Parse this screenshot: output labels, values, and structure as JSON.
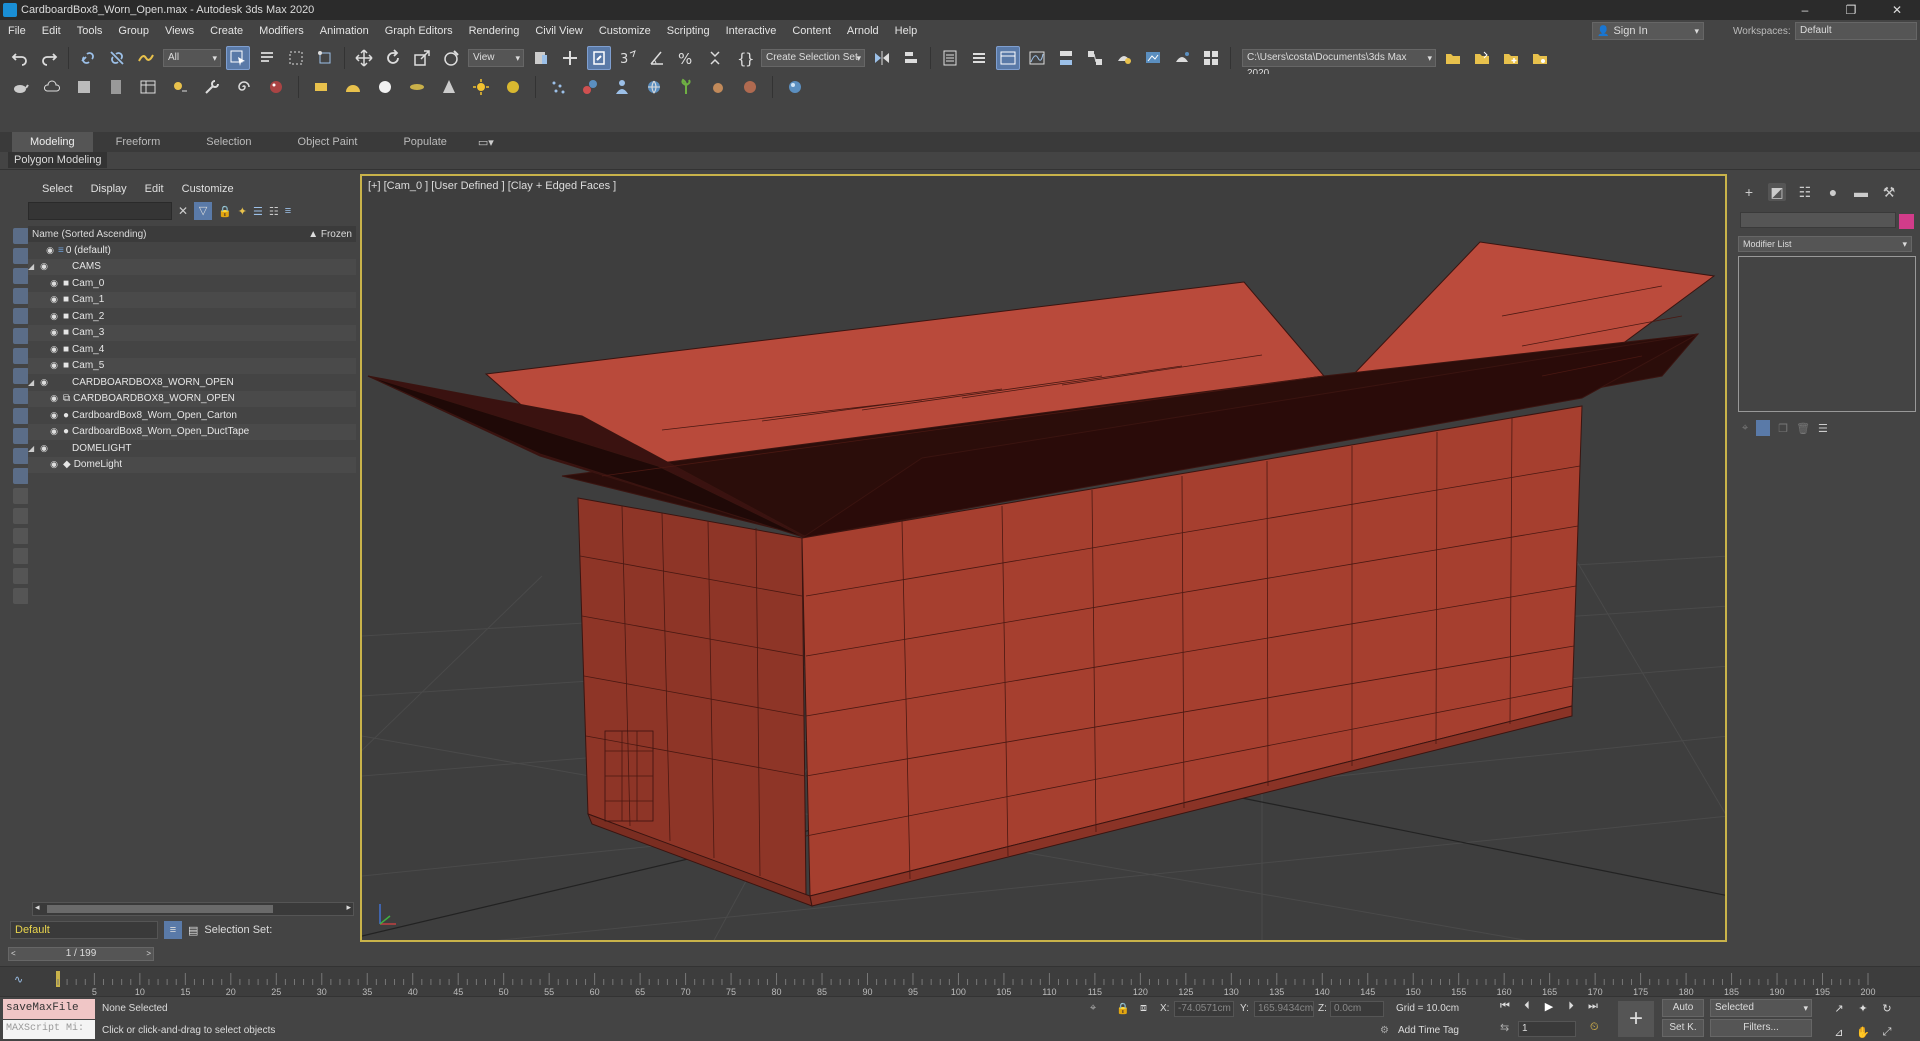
{
  "window": {
    "title": "CardboardBox8_Worn_Open.max - Autodesk 3ds Max 2020"
  },
  "menu": [
    "File",
    "Edit",
    "Tools",
    "Group",
    "Views",
    "Create",
    "Modifiers",
    "Animation",
    "Graph Editors",
    "Rendering",
    "Civil View",
    "Customize",
    "Scripting",
    "Interactive",
    "Content",
    "Arnold",
    "Help"
  ],
  "account": {
    "signin": "Sign In",
    "workspaces_label": "Workspaces:",
    "workspace": "Default"
  },
  "toolbar": {
    "filter": "All",
    "ref_coord": "View",
    "selection_set": "Create Selection Set",
    "project_path": "C:\\Users\\costa\\Documents\\3ds Max 2020"
  },
  "ribbon": {
    "tabs": [
      "Modeling",
      "Freeform",
      "Selection",
      "Object Paint",
      "Populate"
    ],
    "active": "Modeling",
    "sub": "Polygon Modeling"
  },
  "scene_explorer": {
    "tabs": [
      "Select",
      "Display",
      "Edit",
      "Customize"
    ],
    "column_name": "Name (Sorted Ascending)",
    "column_frozen": "▲ Frozen",
    "rows": [
      {
        "label": "0 (default)"
      },
      {
        "label": "CAMS"
      },
      {
        "label": "Cam_0"
      },
      {
        "label": "Cam_1"
      },
      {
        "label": "Cam_2"
      },
      {
        "label": "Cam_3"
      },
      {
        "label": "Cam_4"
      },
      {
        "label": "Cam_5"
      },
      {
        "label": "CARDBOARDBOX8_WORN_OPEN"
      },
      {
        "label": "CARDBOARDBOX8_WORN_OPEN"
      },
      {
        "label": "CardboardBox8_Worn_Open_Carton"
      },
      {
        "label": "CardboardBox8_Worn_Open_DuctTape"
      },
      {
        "label": "DOMELIGHT"
      },
      {
        "label": "DomeLight"
      }
    ],
    "layer": "Default",
    "selection_set_label": "Selection Set:"
  },
  "viewport": {
    "label": "[+] [Cam_0 ] [User Defined ] [Clay + Edged Faces ]",
    "object_color": "#a84433"
  },
  "command_panel": {
    "modifier_list": "Modifier List",
    "object_color": "#d23c8a"
  },
  "timeline": {
    "frame": "1 / 199",
    "ticks": [
      "5",
      "10",
      "15",
      "20",
      "25",
      "30",
      "35",
      "40",
      "45",
      "50",
      "55",
      "60",
      "65",
      "70",
      "75",
      "80",
      "85",
      "90",
      "95",
      "100",
      "105",
      "110",
      "115",
      "120",
      "125",
      "130",
      "135",
      "140",
      "145",
      "150",
      "155",
      "160",
      "165",
      "170",
      "175",
      "180",
      "185",
      "190",
      "195",
      "200"
    ]
  },
  "status": {
    "maxscript_top": "saveMaxFile",
    "maxscript_bottom": "MAXScript Mi:",
    "selection": "None Selected",
    "prompt": "Click or click-and-drag to select objects",
    "x_label": "X:",
    "x": "-74.0571cm",
    "y_label": "Y:",
    "y": "165.9434cm",
    "z_label": "Z:",
    "z": "0.0cm",
    "grid": "Grid = 10.0cm",
    "add_time_tag": "Add Time Tag",
    "auto": "Auto",
    "set_key": "Set K.",
    "key_mode": "Selected",
    "filters": "Filters...",
    "frame_field": "1"
  }
}
